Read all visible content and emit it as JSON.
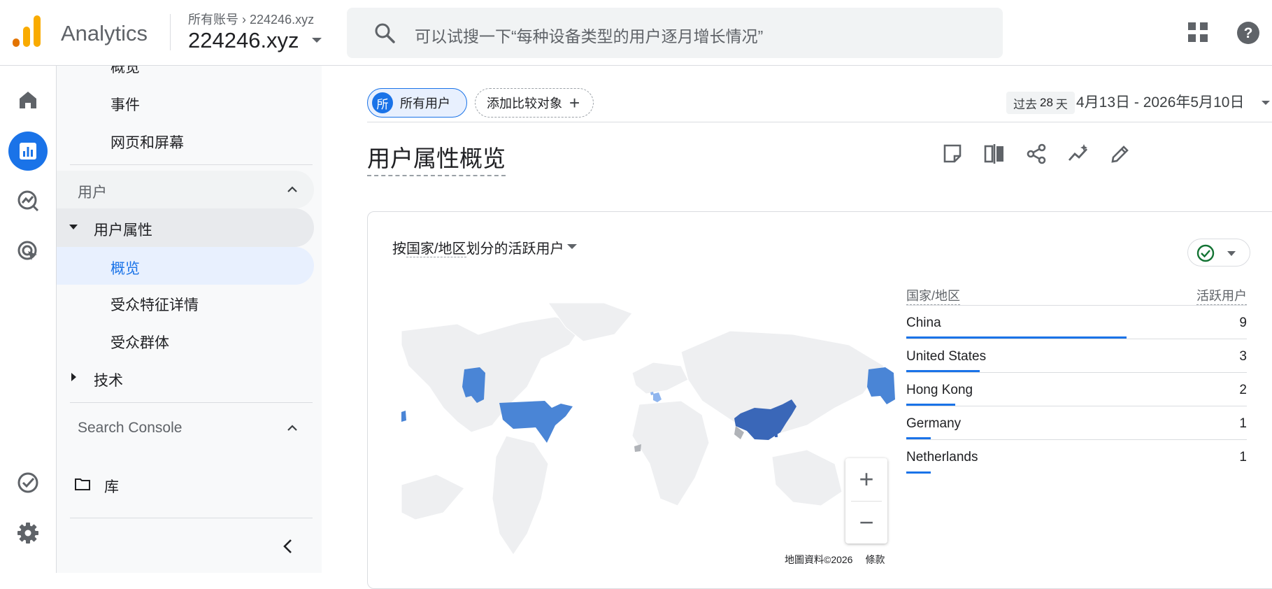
{
  "header": {
    "brand": "Analytics",
    "breadcrumb_account": "所有账号",
    "breadcrumb_property": "224246.xyz",
    "property_name": "224246.xyz",
    "search_placeholder": "可以试搜一下“每种设备类型的用户逐月增长情况”"
  },
  "rail": {
    "items": [
      "home-icon",
      "reports-icon",
      "explore-icon",
      "advertising-icon",
      "admin-check-icon",
      "settings-icon"
    ],
    "active": "reports-icon"
  },
  "sidenav": {
    "partial_top": "概览",
    "events": "事件",
    "pages": "网页和屏幕",
    "users_section": "用户",
    "user_attributes": "用户属性",
    "overview": "概览",
    "audience_details": "受众特征详情",
    "audiences": "受众群体",
    "tech": "技术",
    "search_console": "Search Console",
    "library": "库"
  },
  "toolbar": {
    "segment_badge": "所",
    "segment_all": "所有用户",
    "add_comparison": "添加比较对象",
    "date_past_prefix": "过去",
    "date_past_num": "28",
    "date_past_suffix": "天",
    "date_range": "4月13日 - 2026年5月10日"
  },
  "page": {
    "title": "用户属性概览"
  },
  "card": {
    "title_prefix": "按",
    "title_dimension": "国家/地区",
    "title_suffix": "划分的活跃用户",
    "map_credit": "地圖資料©2026",
    "map_terms": "條款",
    "table_header_country": "国家/地区",
    "table_header_users": "活跃用户",
    "rows": [
      {
        "country": "China",
        "users": "9",
        "share": 1.0
      },
      {
        "country": "United States",
        "users": "3",
        "share": 0.333
      },
      {
        "country": "Hong Kong",
        "users": "2",
        "share": 0.222
      },
      {
        "country": "Germany",
        "users": "1",
        "share": 0.111
      },
      {
        "country": "Netherlands",
        "users": "1",
        "share": 0.111
      }
    ]
  },
  "colors": {
    "accent": "#1a73e8",
    "map_china": "#3a67b8",
    "map_us": "#4a85d6",
    "map_land": "#f0f1f2"
  }
}
